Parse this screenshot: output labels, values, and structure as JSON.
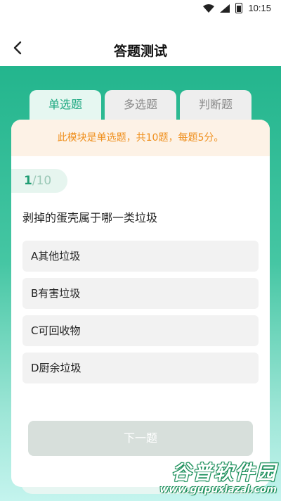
{
  "status_bar": {
    "time": "10:15",
    "icons": [
      "wifi-icon",
      "signal-icon",
      "battery-icon"
    ]
  },
  "header": {
    "title": "答题测试",
    "back_icon": "chevron-left-icon"
  },
  "tabs": [
    {
      "label": "单选题",
      "active": true
    },
    {
      "label": "多选题",
      "active": false
    },
    {
      "label": "判断题",
      "active": false
    }
  ],
  "notice": "此模块是单选题，共10题，每题5分。",
  "progress": {
    "current": "1",
    "total": "/10"
  },
  "question": "剥掉的蛋壳属于哪一类垃圾",
  "options": [
    {
      "label": "A其他垃圾"
    },
    {
      "label": "B有害垃圾"
    },
    {
      "label": "C可回收物"
    },
    {
      "label": "D厨余垃圾"
    }
  ],
  "next_button": "下一题",
  "watermark": {
    "title": "谷普软件园",
    "url": "www.gupuxlazal.com"
  },
  "colors": {
    "accent": "#23b58d",
    "active_tab_text": "#1aa77f",
    "notice_text": "#ef8f1c",
    "notice_bg": "#fdf2e6",
    "disabled_button": "#d7dfdb"
  }
}
